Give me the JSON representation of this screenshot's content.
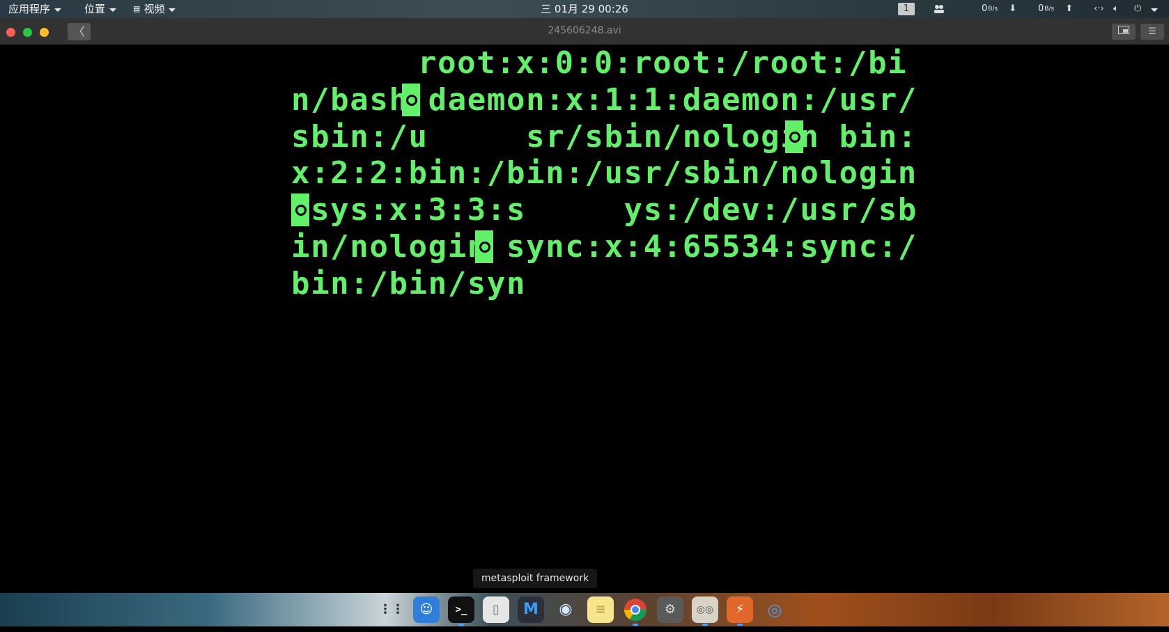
{
  "top_panel": {
    "menus": [
      {
        "label": "应用程序"
      },
      {
        "label": "位置"
      },
      {
        "icon": "video-icon",
        "label": "视频"
      }
    ],
    "clock": "三 01月 29 00:26",
    "workspace": "1",
    "net_down": {
      "value": "0",
      "unit": "B/s"
    },
    "net_up": {
      "value": "0",
      "unit": "B/s"
    },
    "tray_icons": [
      "people-icon",
      "download-arrow-icon",
      "upload-arrow-icon",
      "network-icon",
      "volume-icon",
      "power-icon"
    ]
  },
  "window": {
    "title": "245606248.avi",
    "traffic_lights": {
      "close": "#ff5f57",
      "maximize": "#28c840",
      "minimize": "#ffbd2e"
    },
    "back_label": "〈",
    "buttons": [
      "pip-icon",
      "menu-icon"
    ]
  },
  "video_text": {
    "color": "#62f06a",
    "lines": [
      "root:x:0:0:root:/root:/bi",
      "n/bash daemon:x:1:1:daemon:/usr/",
      "sbin:/u     sr/sbin/nologin bin:",
      "x:2:2:bin:/bin:/usr/sbin/nologin",
      " sys:x:3:3:s     ys:/dev:/usr/sb",
      "in/nologin sync:x:4:65534:sync:/",
      "bin:/bin/syn"
    ]
  },
  "tooltip": "metasploit framework",
  "dock": {
    "items": [
      "launcher-icon",
      "finder-icon",
      "terminal-icon",
      "files-icon",
      "metasploit-icon",
      "eye-icon",
      "notes-icon",
      "chrome-icon",
      "settings-icon",
      "audio-mixer-icon",
      "burpsuite-icon",
      "browser-icon"
    ]
  }
}
